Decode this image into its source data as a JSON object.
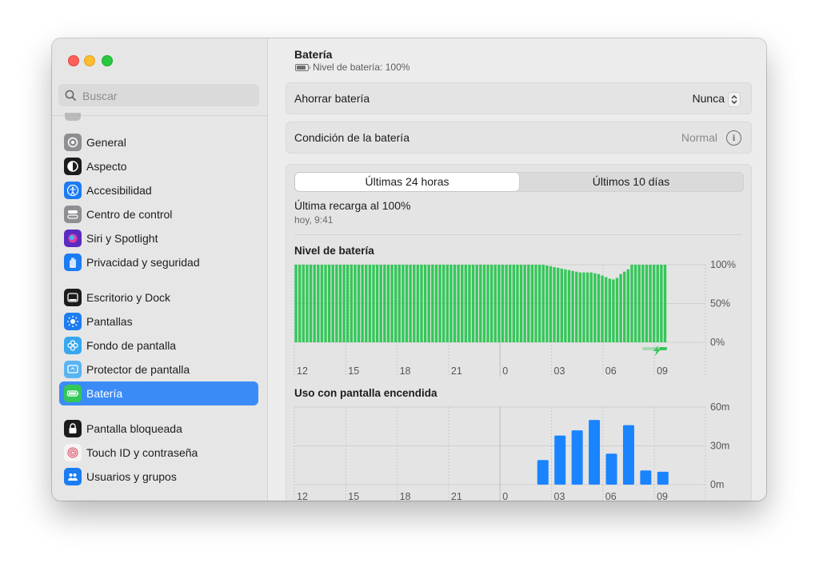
{
  "sidebar": {
    "search_placeholder": "Buscar",
    "items": [
      {
        "label": "General",
        "icon": "gear-icon",
        "color": "#8e8e93"
      },
      {
        "label": "Aspecto",
        "icon": "appearance-icon",
        "color": "#1c1c1e"
      },
      {
        "label": "Accesibilidad",
        "icon": "accessibility-icon",
        "color": "#1c7cf2"
      },
      {
        "label": "Centro de control",
        "icon": "control-center-icon",
        "color": "#8e8e93"
      },
      {
        "label": "Siri y Spotlight",
        "icon": "siri-icon",
        "color": "#5b2bc1"
      },
      {
        "label": "Privacidad y seguridad",
        "icon": "hand-icon",
        "color": "#1c7cf2"
      },
      {
        "label": "Escritorio y Dock",
        "icon": "dock-icon",
        "color": "#1c1c1e"
      },
      {
        "label": "Pantallas",
        "icon": "sun-icon",
        "color": "#1c7cf2"
      },
      {
        "label": "Fondo de pantalla",
        "icon": "wallpaper-icon",
        "color": "#36a7f0"
      },
      {
        "label": "Protector de pantalla",
        "icon": "screensaver-icon",
        "color": "#5ab4f2"
      },
      {
        "label": "Batería",
        "icon": "battery-icon",
        "color": "#34c759"
      },
      {
        "label": "Pantalla bloqueada",
        "icon": "lock-icon",
        "color": "#1c1c1e"
      },
      {
        "label": "Touch ID y contraseña",
        "icon": "fingerprint-icon",
        "color": "#f4f4f4"
      },
      {
        "label": "Usuarios y grupos",
        "icon": "users-icon",
        "color": "#1c7cf2"
      }
    ],
    "selected_index": 10
  },
  "header": {
    "title": "Batería",
    "subtitle": "Nivel de batería: 100%"
  },
  "settings": {
    "save_label": "Ahorrar batería",
    "save_value": "Nunca",
    "health_label": "Condición de la batería",
    "health_value": "Normal"
  },
  "tabs": {
    "active": "Últimas 24 horas",
    "inactive": "Últimos 10 días"
  },
  "recharge": {
    "title": "Última recarga al 100%",
    "time": "hoy, 9:41"
  },
  "chart_data": [
    {
      "type": "bar",
      "title": "Nivel de batería",
      "x_tick_labels": [
        "12",
        "15",
        "18",
        "21",
        "0",
        "03",
        "06",
        "09"
      ],
      "y_tick_labels": [
        "100%",
        "50%",
        "0%"
      ],
      "ylim": [
        0,
        100
      ],
      "values": [
        100,
        100,
        100,
        100,
        100,
        100,
        100,
        100,
        100,
        100,
        100,
        100,
        100,
        100,
        100,
        100,
        100,
        100,
        100,
        100,
        100,
        100,
        100,
        100,
        100,
        100,
        100,
        100,
        100,
        100,
        100,
        100,
        100,
        100,
        100,
        100,
        100,
        100,
        100,
        100,
        100,
        100,
        100,
        100,
        100,
        100,
        100,
        100,
        100,
        100,
        100,
        100,
        100,
        100,
        100,
        100,
        100,
        100,
        100,
        100,
        100,
        100,
        100,
        100,
        100,
        100,
        100,
        100,
        99,
        98,
        97,
        96,
        95,
        94,
        93,
        92,
        91,
        90,
        90,
        90,
        90,
        89,
        88,
        86,
        84,
        82,
        81,
        83,
        88,
        91,
        94,
        100,
        100,
        100,
        100,
        100,
        100,
        100,
        100,
        100,
        100
      ],
      "charging_from_index": 96,
      "color": "#34c759"
    },
    {
      "type": "bar",
      "title": "Uso con pantalla encendida",
      "x_tick_labels": [
        "12",
        "15",
        "18",
        "21",
        "0",
        "03",
        "06",
        "09"
      ],
      "y_tick_labels": [
        "60m",
        "30m",
        "0m"
      ],
      "ylim": [
        0,
        60
      ],
      "categories_count": 24,
      "values": [
        0,
        0,
        0,
        0,
        0,
        0,
        0,
        0,
        0,
        0,
        0,
        0,
        0,
        0,
        19,
        38,
        42,
        50,
        24,
        46,
        11,
        10,
        0,
        0
      ],
      "color": "#1a84ff"
    }
  ]
}
